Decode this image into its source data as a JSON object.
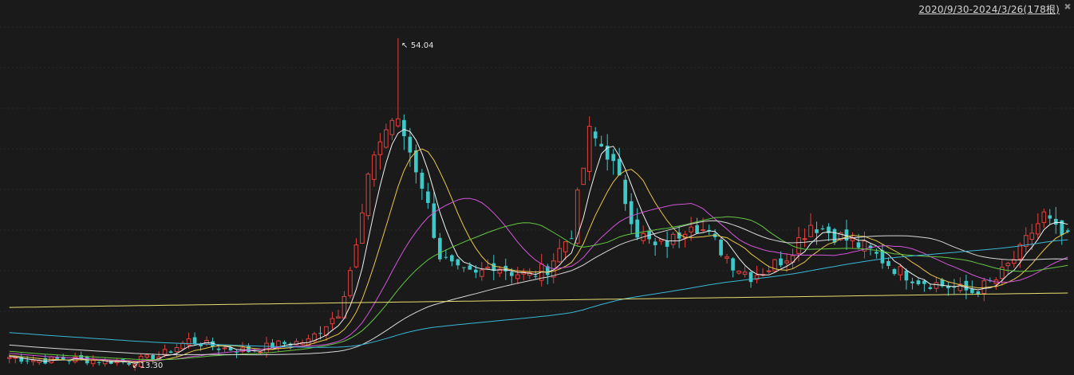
{
  "header": {
    "range_label": "2020/9/30-2024/3/26(178根)"
  },
  "colors": {
    "background": "#1a1a1a",
    "grid": "#2a2a2a",
    "up": "#e3403c",
    "down": "#3ec8c8",
    "ma_white": "#f2f2f2",
    "ma_yellow": "#e8c64a",
    "ma_magenta": "#d254d8",
    "ma_green": "#62c642",
    "ma_light": "#d8d8d8",
    "ma_cyan": "#3ab8d8",
    "ma_longyellow": "#e8e070"
  },
  "icons": {
    "pin": "pin-icon"
  },
  "chart_data": {
    "type": "candlestick",
    "periods": 178,
    "start_date": "2020/9/30",
    "end_date": "2024/3/26",
    "ylim": [
      12.5,
      56
    ],
    "grid": true,
    "annotations": {
      "high": {
        "label": "54.04",
        "value": 54.04,
        "index": 65
      },
      "low": {
        "label": "13.30",
        "value": 13.3,
        "index": 20
      }
    },
    "anchors": [
      [
        0,
        14.4
      ],
      [
        5,
        14.0
      ],
      [
        10,
        14.2
      ],
      [
        15,
        14.0
      ],
      [
        20,
        13.8
      ],
      [
        25,
        14.5
      ],
      [
        30,
        16.5
      ],
      [
        35,
        15.6
      ],
      [
        40,
        15.2
      ],
      [
        45,
        16.0
      ],
      [
        50,
        16.4
      ],
      [
        55,
        20.0
      ],
      [
        58,
        28.0
      ],
      [
        61,
        40.0
      ],
      [
        64,
        44.0
      ],
      [
        66,
        42.0
      ],
      [
        69,
        36.0
      ],
      [
        72,
        27.0
      ],
      [
        75,
        25.0
      ],
      [
        78,
        24.5
      ],
      [
        81,
        26.0
      ],
      [
        84,
        25.0
      ],
      [
        87,
        24.5
      ],
      [
        90,
        25.5
      ],
      [
        94,
        30.0
      ],
      [
        97,
        42.0
      ],
      [
        100,
        40.0
      ],
      [
        103,
        34.0
      ],
      [
        105,
        30.0
      ],
      [
        108,
        28.0
      ],
      [
        111,
        29.0
      ],
      [
        114,
        31.5
      ],
      [
        117,
        29.5
      ],
      [
        121,
        26.0
      ],
      [
        124,
        24.5
      ],
      [
        127,
        25.5
      ],
      [
        130,
        27.0
      ],
      [
        134,
        31.0
      ],
      [
        137,
        30.0
      ],
      [
        140,
        29.0
      ],
      [
        143,
        28.0
      ],
      [
        146,
        26.5
      ],
      [
        149,
        25.0
      ],
      [
        152,
        24.0
      ],
      [
        155,
        23.5
      ],
      [
        158,
        23.0
      ],
      [
        161,
        22.5
      ],
      [
        165,
        24.0
      ],
      [
        169,
        27.5
      ],
      [
        171,
        30.0
      ],
      [
        173,
        32.0
      ],
      [
        175,
        30.0
      ],
      [
        177,
        29.0
      ]
    ],
    "ma_periods": [
      5,
      10,
      20,
      30,
      60,
      120,
      250
    ],
    "ma_colors": [
      "#f2f2f2",
      "#e8c64a",
      "#d254d8",
      "#62c642",
      "#d8d8d8",
      "#3ab8d8",
      "#e8e070"
    ]
  }
}
